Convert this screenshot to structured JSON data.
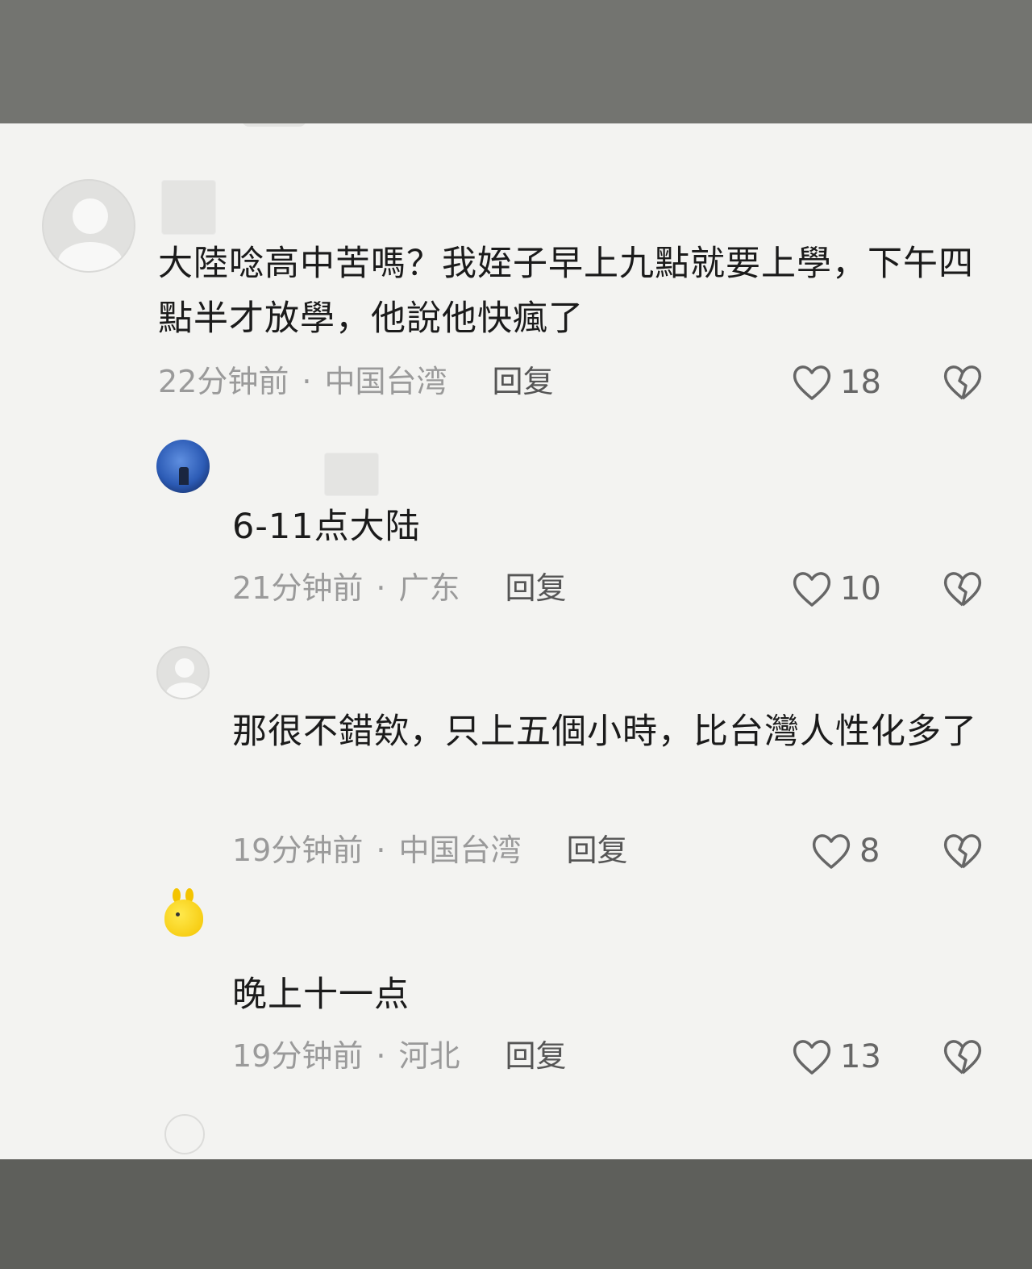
{
  "comments": [
    {
      "text": "大陸唸高中苦嗎？我姪子早上九點就要上學，下午四點半才放學，他說他快瘋了",
      "time": "22分钟前",
      "location": "中国台湾",
      "reply_label": "回复",
      "likes": "18",
      "avatar_icon": "default-user-icon"
    },
    {
      "text": "6-11点大陆",
      "time": "21分钟前",
      "location": "广东",
      "reply_label": "回复",
      "likes": "10",
      "avatar_icon": "photo-avatar"
    },
    {
      "text": "那很不錯欸，只上五個小時，比台灣人性化多了",
      "time": "19分钟前",
      "location": "中国台湾",
      "reply_label": "回复",
      "likes": "8",
      "avatar_icon": "default-user-icon"
    },
    {
      "text": "晚上十一点",
      "time": "19分钟前",
      "location": "河北",
      "reply_label": "回复",
      "likes": "13",
      "avatar_icon": "yellow-duck-avatar"
    }
  ],
  "separator": "·",
  "icons": {
    "like": "heart-icon",
    "dislike": "broken-heart-icon"
  },
  "colors": {
    "text": "#1b1b1b",
    "meta": "#9a9a9a",
    "panel": "#f3f3f1",
    "frame": "#6f706b"
  }
}
